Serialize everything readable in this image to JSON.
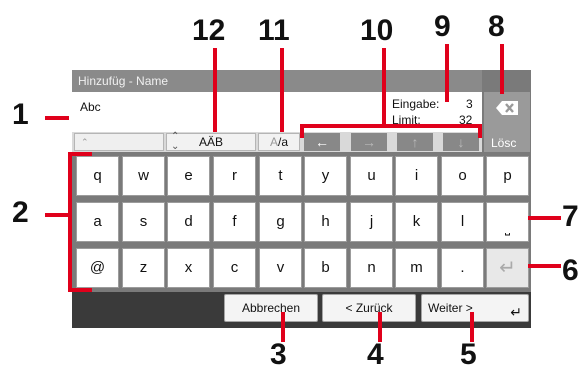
{
  "window": {
    "title": "Hinzufüg - Name"
  },
  "input": {
    "value": "Abc"
  },
  "counter": {
    "entry_label": "Eingabe:",
    "entry_value": "3",
    "limit_label": "Limit:",
    "limit_value": "32"
  },
  "delete_key": {
    "label": "Lösc",
    "icon": "backspace-icon"
  },
  "toolbar": {
    "charset_label": "AÄB",
    "case_label_a": "A",
    "case_label_b": "/a",
    "arrows": [
      "←",
      "→",
      "↑",
      "↓"
    ]
  },
  "keyboard": {
    "row1": [
      "q",
      "w",
      "e",
      "r",
      "t",
      "y",
      "u",
      "i",
      "o",
      "p"
    ],
    "row2": [
      "a",
      "s",
      "d",
      "f",
      "g",
      "h",
      "j",
      "k",
      "l",
      "⎵"
    ],
    "row3": [
      "@",
      "z",
      "x",
      "c",
      "v",
      "b",
      "n",
      "m",
      ".",
      "↵"
    ]
  },
  "footer": {
    "cancel_label": "Abbrechen",
    "back_label": "< Zurück",
    "next_label": "Weiter >"
  },
  "callouts": [
    "1",
    "2",
    "3",
    "4",
    "5",
    "6",
    "7",
    "8",
    "9",
    "10",
    "11",
    "12"
  ],
  "colors": {
    "callout_line": "#e0001b",
    "panel": "#7a7a7a",
    "bottom_bar": "#3a3a3a"
  }
}
